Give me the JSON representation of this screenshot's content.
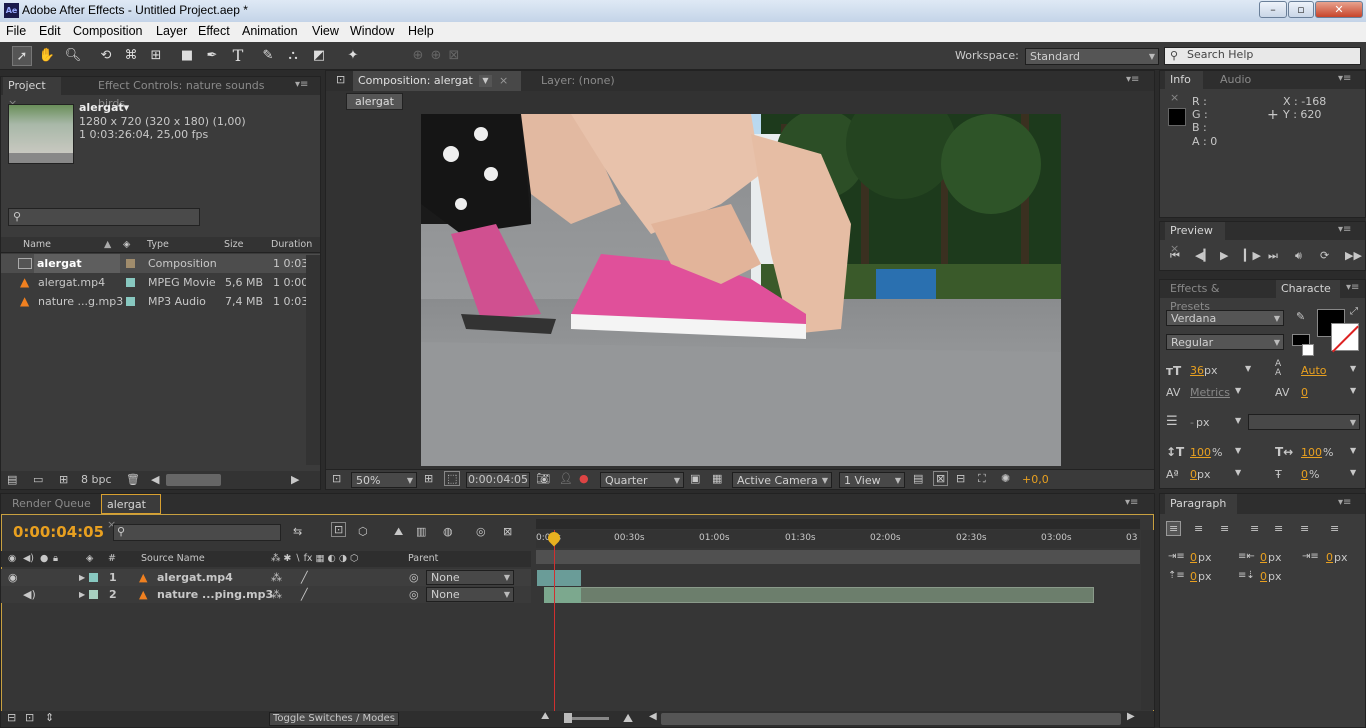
{
  "window": {
    "title": "Adobe After Effects - Untitled Project.aep *",
    "app_icon": "Ae",
    "min": "–",
    "max": "▫",
    "close": "✕"
  },
  "menu": [
    "File",
    "Edit",
    "Composition",
    "Layer",
    "Effect",
    "Animation",
    "View",
    "Window",
    "Help"
  ],
  "toolbar": {
    "workspace_label": "Workspace:",
    "workspace_value": "Standard",
    "search_placeholder": "Search Help",
    "tools": [
      "selection-tool-icon",
      "hand-tool-icon",
      "zoom-tool-icon",
      "rotation-tool-icon",
      "camera-orbit-icon",
      "pan-behind-icon",
      "rectangle-tool-icon",
      "pen-tool-icon",
      "type-tool-icon",
      "brush-tool-icon",
      "clone-stamp-icon",
      "eraser-tool-icon",
      "puppet-pin-icon",
      "axis-icon-1",
      "axis-icon-2",
      "axis-icon-3"
    ]
  },
  "project_panel": {
    "tab_project": "Project",
    "tab_effect_controls": "Effect Controls: nature sounds birds",
    "selected_name": "alergat▾",
    "selected_info1": "1280 x 720  (320 x 180) (1,00)",
    "selected_info2": "1 0:03:26:04, 25,00 fps",
    "columns": [
      "Name",
      "Type",
      "Size",
      "Duration"
    ],
    "items": [
      {
        "name": "alergat",
        "label_color": "#a08c6c",
        "type": "Composition",
        "size": "",
        "duration": "1 0:03"
      },
      {
        "name": "alergat.mp4",
        "label_color": "#88c8c0",
        "type": "MPEG Movie",
        "size": "5,6 MB",
        "duration": "1 0:00"
      },
      {
        "name": "nature ...g.mp3",
        "label_color": "#88c8c0",
        "type": "MP3 Audio",
        "size": "7,4 MB",
        "duration": "1 0:03"
      }
    ],
    "bpc": "8 bpc"
  },
  "composition_panel": {
    "tab_comp": "Composition: alergat",
    "tab_layer": "Layer: (none)",
    "breadcrumb": "alergat",
    "zoom": "50%",
    "timecode": "0:00:04:05",
    "resolution": "Quarter",
    "camera": "Active Camera",
    "views": "1 View",
    "exposure": "+0,0"
  },
  "info_panel": {
    "tab_info": "Info",
    "tab_audio": "Audio",
    "r": "R :",
    "g": "G :",
    "b": "B :",
    "a": "A : 0",
    "x": "X : -168",
    "y": "Y : 620"
  },
  "preview_panel": {
    "tab": "Preview"
  },
  "character_panel": {
    "tab_effects": "Effects & Presets",
    "tab_character": "Characte",
    "font": "Verdana",
    "style": "Regular",
    "size": "36",
    "size_unit": "px",
    "leading": "Auto",
    "kerning": "Metrics",
    "tracking": "0",
    "stroke_unit": "px",
    "vscale": "100",
    "hscale": "100",
    "pct": "%",
    "baseline": "0",
    "baseline_unit": "px",
    "tsume": "0",
    "fill_color": "#000000"
  },
  "paragraph_panel": {
    "tab": "Paragraph",
    "indent_left": "0",
    "indent_right": "0",
    "first_line": "0",
    "space_before": "0",
    "space_after": "0",
    "unit": "px"
  },
  "timeline": {
    "tab_render": "Render Queue",
    "tab_comp": "alergat",
    "timecode": "0:00:04:05",
    "columns": {
      "num": "#",
      "source": "Source Name",
      "parent": "Parent"
    },
    "ruler": [
      "0:00s",
      "00:30s",
      "01:00s",
      "01:30s",
      "02:00s",
      "02:30s",
      "03:00s",
      "03"
    ],
    "layers": [
      {
        "num": "1",
        "name": "alergat.mp4",
        "parent": "None",
        "label_color": "#88c8c0"
      },
      {
        "num": "2",
        "name": "nature ...ping.mp3",
        "parent": "None",
        "label_color": "#a8d0c0"
      }
    ],
    "toggle_label": "Toggle Switches / Modes"
  }
}
